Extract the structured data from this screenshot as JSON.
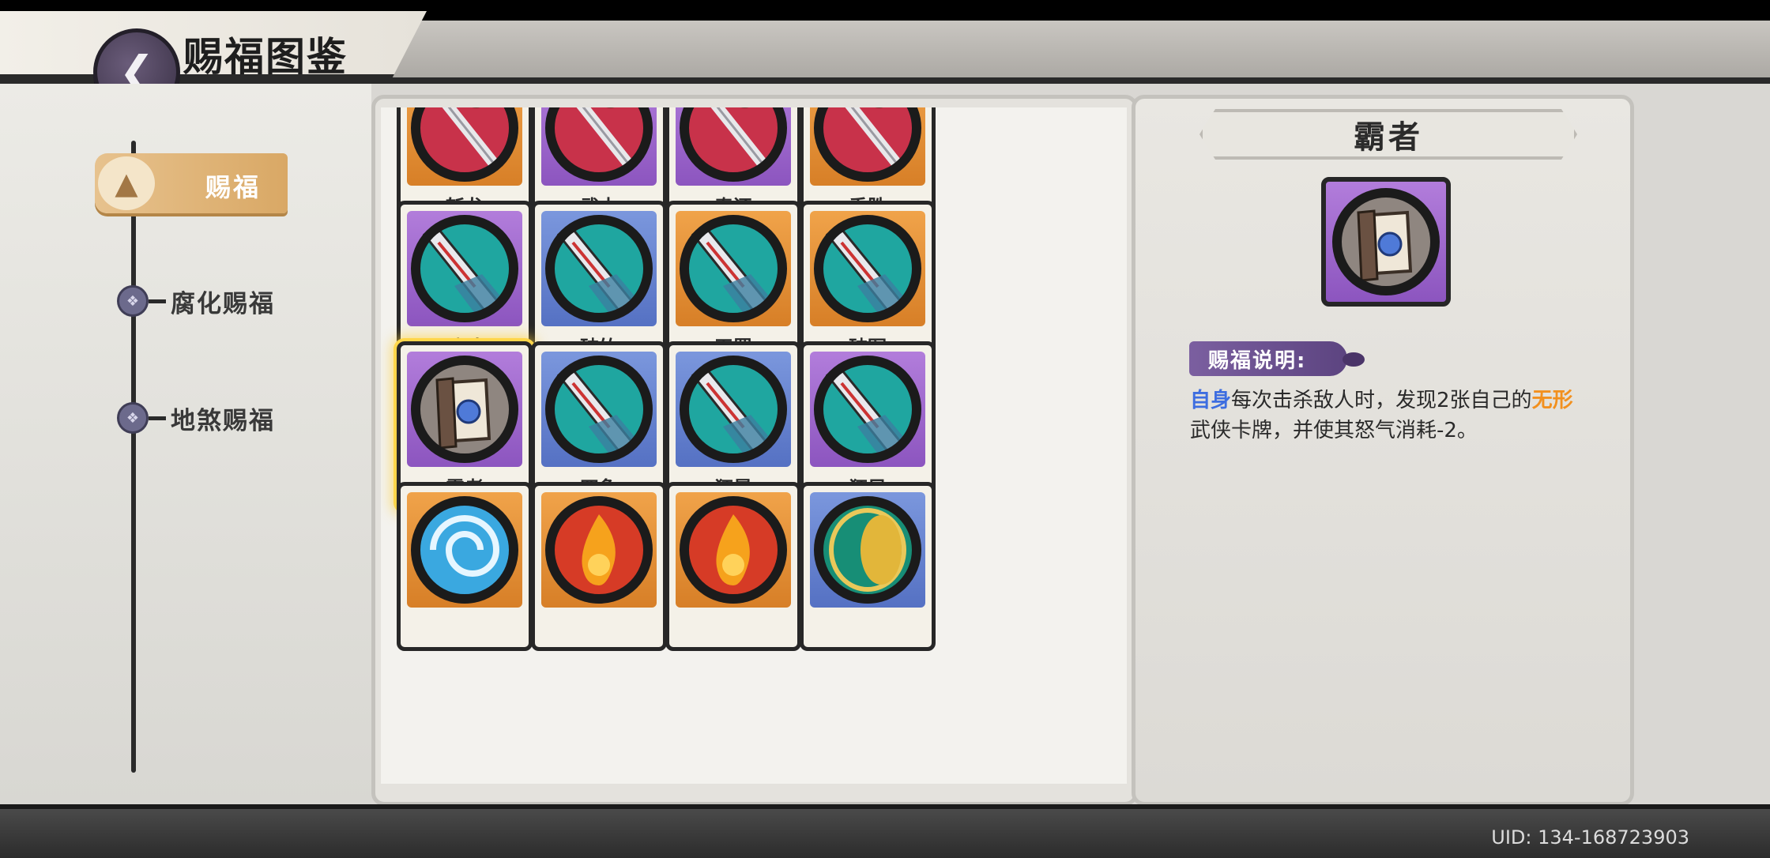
{
  "header": {
    "title": "赐福图鉴",
    "back_icon": "back-arrow-icon"
  },
  "sidebar": {
    "active": {
      "label": "赐福",
      "icon": "straw-hat-icon"
    },
    "items": [
      {
        "label": "腐化赐福",
        "icon": "node-icon"
      },
      {
        "label": "地煞赐福",
        "icon": "node-icon"
      }
    ]
  },
  "grid": {
    "cards": [
      {
        "name": "斩龙",
        "art": "dragon-sword",
        "bg": "orange"
      },
      {
        "name": "武士",
        "art": "dragon-sword",
        "bg": "purple"
      },
      {
        "name": "奉还",
        "art": "dragon-sword",
        "bg": "purple"
      },
      {
        "name": "乘胜",
        "art": "dragon-sword",
        "bg": "orange"
      },
      {
        "name": "碎魂",
        "art": "broad-sword",
        "bg": "purple"
      },
      {
        "name": "破竹",
        "art": "broad-sword",
        "bg": "blue"
      },
      {
        "name": "天罡",
        "art": "broad-sword",
        "bg": "orange"
      },
      {
        "name": "破军",
        "art": "broad-sword",
        "bg": "orange"
      },
      {
        "name": "霸者",
        "art": "scroll",
        "bg": "purple",
        "selected": true
      },
      {
        "name": "四象",
        "art": "broad-sword",
        "bg": "blue"
      },
      {
        "name": "狂暴",
        "art": "broad-sword",
        "bg": "blue"
      },
      {
        "name": "狂风",
        "art": "broad-sword",
        "bg": "purple"
      },
      {
        "name": "",
        "art": "vortex",
        "bg": "orange"
      },
      {
        "name": "",
        "art": "flame",
        "bg": "orange"
      },
      {
        "name": "",
        "art": "flame",
        "bg": "orange"
      },
      {
        "name": "",
        "art": "drum",
        "bg": "blue"
      }
    ]
  },
  "detail": {
    "title": "霸者",
    "icon": "scroll-icon",
    "desc_label": "赐福说明:",
    "desc": {
      "p1": "自身",
      "p2": "每次击杀敌人时，发现2张自己的",
      "p3": "无形",
      "p4": "武侠卡牌，并使其怒气消耗-2。"
    }
  },
  "footer": {
    "uid": "UID: 134-168723903"
  },
  "colors": {
    "accent_gold": "#d9a865",
    "highlight_blue": "#3d6de0",
    "highlight_orange": "#f2901e"
  }
}
